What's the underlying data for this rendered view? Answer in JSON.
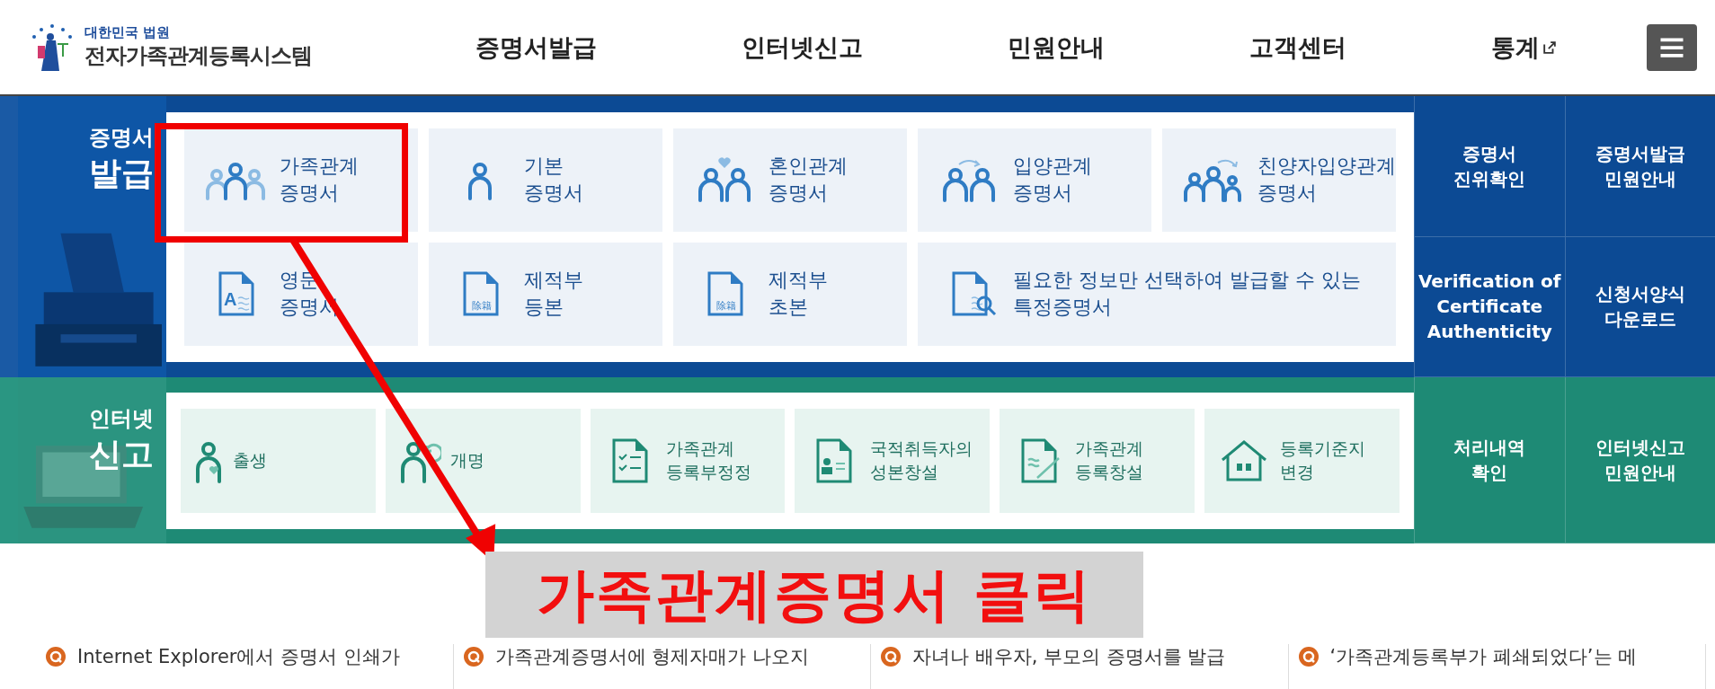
{
  "header": {
    "logo_top": "대한민국 법원",
    "logo_title": "전자가족관계등록시스템",
    "nav": [
      {
        "label": "증명서발급",
        "external": false
      },
      {
        "label": "인터넷신고",
        "external": false
      },
      {
        "label": "민원안내",
        "external": false
      },
      {
        "label": "고객센터",
        "external": false
      },
      {
        "label": "통계",
        "external": true
      }
    ]
  },
  "certificate_section": {
    "title_small": "증명서",
    "title_large": "발급",
    "tiles": [
      {
        "kind": "family",
        "wide": false,
        "lines": [
          "가족관계",
          "증명서"
        ]
      },
      {
        "kind": "person",
        "wide": false,
        "lines": [
          "기본",
          "증명서"
        ]
      },
      {
        "kind": "couple-heart",
        "wide": false,
        "lines": [
          "혼인관계",
          "증명서"
        ]
      },
      {
        "kind": "couple-arrow",
        "wide": false,
        "lines": [
          "입양관계",
          "증명서"
        ]
      },
      {
        "kind": "family-arrow",
        "wide": false,
        "lines": [
          "친양자입양관계",
          "증명서"
        ]
      },
      {
        "kind": "doc-letter",
        "wide": false,
        "icon_text": "A",
        "lines": [
          "영문",
          "증명서"
        ]
      },
      {
        "kind": "doc-stamp",
        "wide": false,
        "icon_text": "除籍",
        "lines": [
          "제적부",
          "등본"
        ]
      },
      {
        "kind": "doc-stamp",
        "wide": false,
        "icon_text": "除籍",
        "lines": [
          "제적부",
          "초본"
        ]
      },
      {
        "kind": "doc-search",
        "wide": true,
        "lines": [
          "필요한 정보만 선택하여 발급할 수 있는",
          "특정증명서"
        ]
      }
    ],
    "links": [
      {
        "lines": [
          "증명서",
          "진위확인"
        ]
      },
      {
        "lines": [
          "증명서발급",
          "민원안내"
        ]
      },
      {
        "lines": [
          "Verification of",
          "Certificate",
          "Authenticity"
        ]
      },
      {
        "lines": [
          "신청서양식",
          "다운로드"
        ]
      }
    ]
  },
  "report_section": {
    "title_small": "인터넷",
    "title_large": "신고",
    "tiles": [
      {
        "kind": "pregnant",
        "lines": [
          "출생"
        ]
      },
      {
        "kind": "person-refresh",
        "lines": [
          "개명"
        ]
      },
      {
        "kind": "checklist",
        "lines": [
          "가족관계",
          "등록부정정"
        ]
      },
      {
        "kind": "id-doc",
        "lines": [
          "국적취득자의",
          "성본창설"
        ]
      },
      {
        "kind": "doc-pen",
        "lines": [
          "가족관계",
          "등록창설"
        ]
      },
      {
        "kind": "house",
        "lines": [
          "등록기준지",
          "변경"
        ]
      }
    ],
    "links": [
      {
        "lines": [
          "처리내역",
          "확인"
        ]
      },
      {
        "lines": [
          "인터넷신고",
          "민원안내"
        ]
      }
    ]
  },
  "faq": [
    {
      "text": "Internet Explorer에서 증명서 인쇄가"
    },
    {
      "text": "가족관계증명서에 형제자매가 나오지"
    },
    {
      "text": "자녀나 배우자, 부모의 증명서를 발급"
    },
    {
      "text": "‘가족관계등록부가 폐쇄되었다’는 메"
    }
  ],
  "annotation": {
    "caption": "가족관계증명서 클릭"
  }
}
